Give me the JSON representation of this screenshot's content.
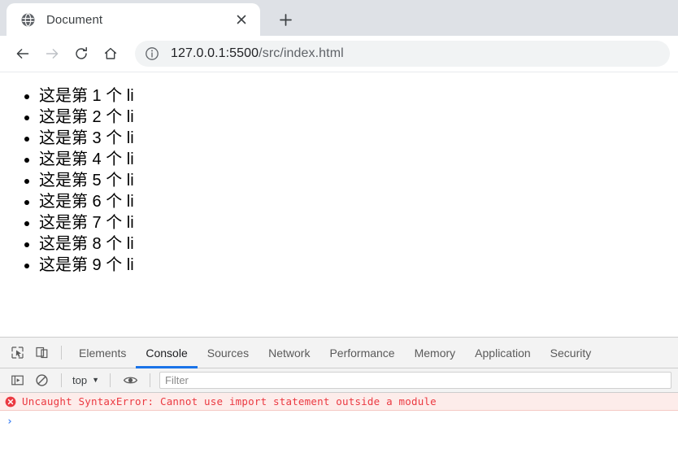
{
  "browser": {
    "tab": {
      "title": "Document",
      "favicon_icon": "globe-icon",
      "close_icon": "close-icon"
    },
    "new_tab": {
      "label": "+",
      "icon": "plus-icon"
    },
    "toolbar": {
      "back_icon": "arrow-left-icon",
      "forward_icon": "arrow-right-icon",
      "reload_icon": "reload-icon",
      "home_icon": "home-icon",
      "site_info_icon": "info-circle-icon",
      "url_host": "127.0.0.1:5500",
      "url_path": "/src/index.html",
      "url_full": "127.0.0.1:5500/src/index.html"
    }
  },
  "page": {
    "list_items": [
      "这是第 1 个 li",
      "这是第 2 个 li",
      "这是第 3 个 li",
      "这是第 4 个 li",
      "这是第 5 个 li",
      "这是第 6 个 li",
      "这是第 7 个 li",
      "这是第 8 个 li",
      "这是第 9 个 li"
    ]
  },
  "devtools": {
    "inspect_icon": "inspect-cursor-icon",
    "device_toolbar_icon": "device-toolbar-icon",
    "tabs": [
      {
        "label": "Elements",
        "selected": false
      },
      {
        "label": "Console",
        "selected": true
      },
      {
        "label": "Sources",
        "selected": false
      },
      {
        "label": "Network",
        "selected": false
      },
      {
        "label": "Performance",
        "selected": false
      },
      {
        "label": "Memory",
        "selected": false
      },
      {
        "label": "Application",
        "selected": false
      },
      {
        "label": "Security",
        "selected": false
      }
    ],
    "console_toolbar": {
      "sidebar_icon": "console-sidebar-icon",
      "clear_icon": "clear-console-icon",
      "context_label": "top",
      "context_caret": "▼",
      "eye_icon": "eye-icon",
      "filter_placeholder": "Filter"
    },
    "messages": [
      {
        "level": "error",
        "icon": "error-badge-icon",
        "text": "Uncaught SyntaxError: Cannot use import statement outside a module"
      }
    ],
    "prompt": {
      "caret": "›",
      "value": ""
    },
    "colors": {
      "accent": "#1a73e8",
      "error_text": "#eb3941",
      "error_background": "#fdecea",
      "prompt_caret": "#4285f4"
    }
  }
}
